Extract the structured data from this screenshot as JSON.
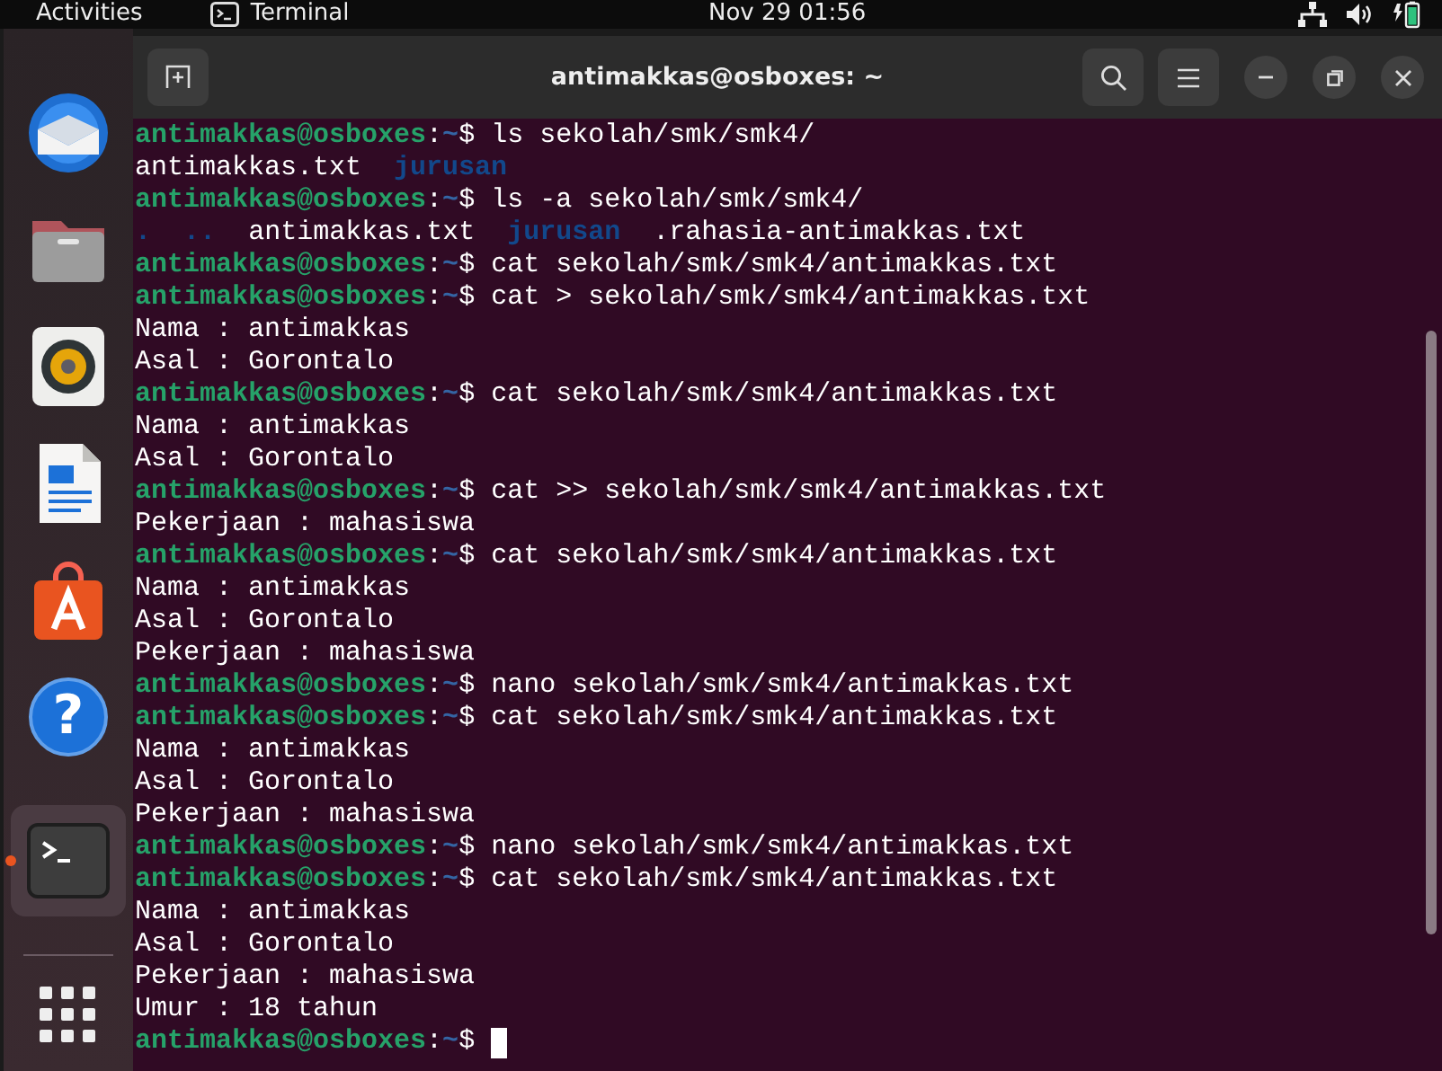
{
  "top_bar": {
    "activities": "Activities",
    "app_name": "Terminal",
    "clock": "Nov 29  01:56"
  },
  "dock": {
    "items": [
      {
        "kind": "mail",
        "active": false
      },
      {
        "kind": "files",
        "active": false
      },
      {
        "kind": "music",
        "active": false
      },
      {
        "kind": "writer",
        "active": false
      },
      {
        "kind": "store",
        "active": false
      },
      {
        "kind": "help",
        "glyph": "?",
        "active": false
      },
      {
        "kind": "terminal",
        "active": true
      },
      {
        "kind": "apps",
        "active": false
      }
    ]
  },
  "window": {
    "title": "antimakkas@osboxes: ~"
  },
  "terminal": {
    "lines": [
      {
        "kind": "prompt",
        "user": "antimakkas@osboxes",
        "sep": ":",
        "path": "~",
        "sign": "$",
        "command": "ls sekolah/smk/smk4/"
      },
      {
        "kind": "listing",
        "entries": [
          {
            "name": "antimakkas.txt",
            "directory": false
          },
          {
            "name": "jurusan",
            "directory": true
          }
        ]
      },
      {
        "kind": "prompt",
        "user": "antimakkas@osboxes",
        "sep": ":",
        "path": "~",
        "sign": "$",
        "command": "ls -a sekolah/smk/smk4/"
      },
      {
        "kind": "listing",
        "entries": [
          {
            "name": ".",
            "directory": true
          },
          {
            "name": "..",
            "directory": true
          },
          {
            "name": "antimakkas.txt",
            "directory": false
          },
          {
            "name": "jurusan",
            "directory": true
          },
          {
            "name": ".rahasia-antimakkas.txt",
            "directory": false
          }
        ]
      },
      {
        "kind": "prompt",
        "user": "antimakkas@osboxes",
        "sep": ":",
        "path": "~",
        "sign": "$",
        "command": "cat sekolah/smk/smk4/antimakkas.txt"
      },
      {
        "kind": "prompt",
        "user": "antimakkas@osboxes",
        "sep": ":",
        "path": "~",
        "sign": "$",
        "command": "cat > sekolah/smk/smk4/antimakkas.txt"
      },
      {
        "kind": "output",
        "text": "Nama : antimakkas"
      },
      {
        "kind": "output",
        "text": "Asal : Gorontalo"
      },
      {
        "kind": "prompt",
        "user": "antimakkas@osboxes",
        "sep": ":",
        "path": "~",
        "sign": "$",
        "command": "cat sekolah/smk/smk4/antimakkas.txt"
      },
      {
        "kind": "output",
        "text": "Nama : antimakkas"
      },
      {
        "kind": "output",
        "text": "Asal : Gorontalo"
      },
      {
        "kind": "prompt",
        "user": "antimakkas@osboxes",
        "sep": ":",
        "path": "~",
        "sign": "$",
        "command": "cat >> sekolah/smk/smk4/antimakkas.txt"
      },
      {
        "kind": "output",
        "text": "Pekerjaan : mahasiswa"
      },
      {
        "kind": "prompt",
        "user": "antimakkas@osboxes",
        "sep": ":",
        "path": "~",
        "sign": "$",
        "command": "cat sekolah/smk/smk4/antimakkas.txt"
      },
      {
        "kind": "output",
        "text": "Nama : antimakkas"
      },
      {
        "kind": "output",
        "text": "Asal : Gorontalo"
      },
      {
        "kind": "output",
        "text": "Pekerjaan : mahasiswa"
      },
      {
        "kind": "prompt",
        "user": "antimakkas@osboxes",
        "sep": ":",
        "path": "~",
        "sign": "$",
        "command": "nano sekolah/smk/smk4/antimakkas.txt"
      },
      {
        "kind": "prompt",
        "user": "antimakkas@osboxes",
        "sep": ":",
        "path": "~",
        "sign": "$",
        "command": "cat sekolah/smk/smk4/antimakkas.txt"
      },
      {
        "kind": "output",
        "text": "Nama : antimakkas"
      },
      {
        "kind": "output",
        "text": "Asal : Gorontalo"
      },
      {
        "kind": "output",
        "text": "Pekerjaan : mahasiswa"
      },
      {
        "kind": "prompt",
        "user": "antimakkas@osboxes",
        "sep": ":",
        "path": "~",
        "sign": "$",
        "command": "nano sekolah/smk/smk4/antimakkas.txt"
      },
      {
        "kind": "prompt",
        "user": "antimakkas@osboxes",
        "sep": ":",
        "path": "~",
        "sign": "$",
        "command": "cat sekolah/smk/smk4/antimakkas.txt"
      },
      {
        "kind": "output",
        "text": "Nama : antimakkas"
      },
      {
        "kind": "output",
        "text": "Asal : Gorontalo"
      },
      {
        "kind": "output",
        "text": "Pekerjaan : mahasiswa"
      },
      {
        "kind": "output",
        "text": "Umur : 18 tahun"
      },
      {
        "kind": "prompt",
        "user": "antimakkas@osboxes",
        "sep": ":",
        "path": "~",
        "sign": "$",
        "cursor": true
      }
    ]
  }
}
